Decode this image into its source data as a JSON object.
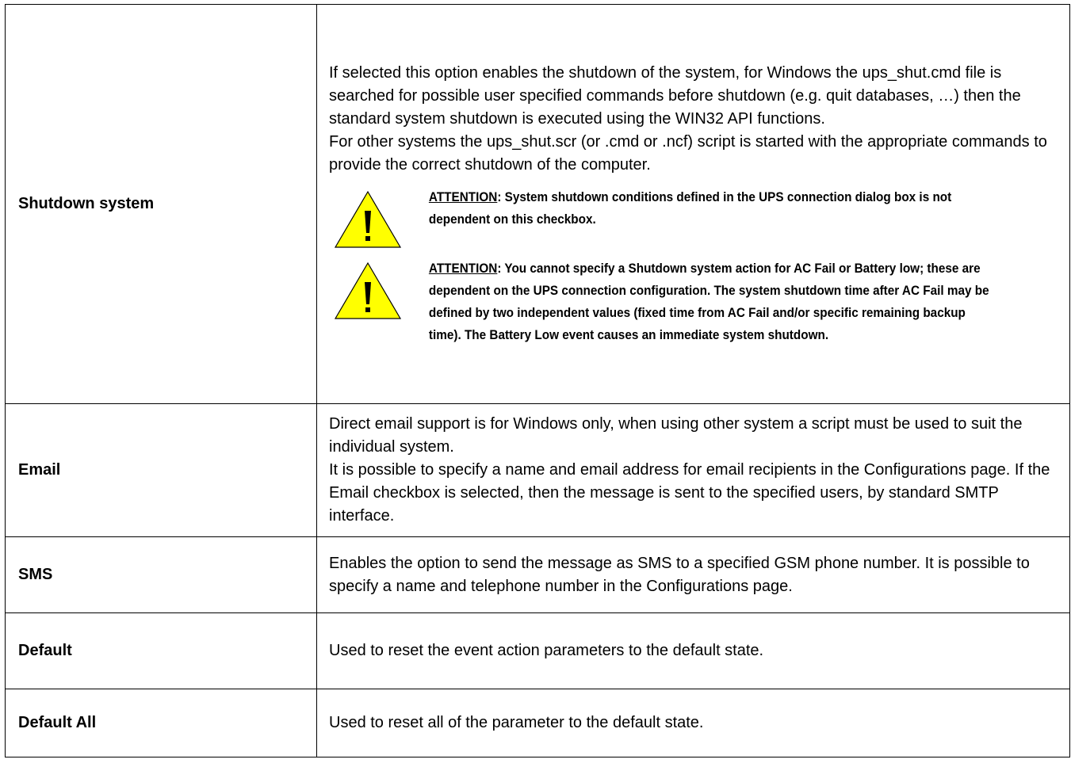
{
  "rows": [
    {
      "label": "Shutdown system",
      "paragraphs": [
        "If selected this option enables the shutdown of the system, for Windows the ups_shut.cmd file is searched for possible user specified commands before shutdown (e.g. quit databases, …) then the standard system shutdown is executed using the WIN32 API functions.",
        "For other systems the ups_shut.scr (or .cmd or .ncf) script is started with the appropriate commands to provide the correct shutdown of the computer."
      ],
      "attentions": [
        {
          "icon": "warning-triangle-icon",
          "label": "ATTENTION",
          "text": ": System shutdown conditions defined in the UPS connection dialog box is not dependent on this checkbox."
        },
        {
          "icon": "warning-triangle-icon",
          "label": "ATTENTION",
          "text": ": You cannot specify a Shutdown system action for AC Fail or Battery low; these are dependent on the UPS connection configuration. The system shutdown time after AC Fail may be defined by two independent values (fixed time from AC Fail and/or specific remaining backup time). The Battery Low event causes an immediate system shutdown."
        }
      ]
    },
    {
      "label": "Email",
      "paragraphs": [
        "Direct email support is for Windows only, when using other system a script must be used to suit the individual system.",
        "It is possible to specify a name and email address for email recipients in the Configurations page. If the Email checkbox is selected, then the message is sent to the specified users, by standard SMTP interface."
      ]
    },
    {
      "label": "SMS",
      "paragraphs": [
        "Enables the option to send the message as SMS to a specified GSM phone number. It is possible to specify a name and telephone number in the Configurations page."
      ]
    },
    {
      "label": "Default",
      "paragraphs": [
        "Used to reset the event action parameters to the default state."
      ]
    },
    {
      "label": "Default All",
      "paragraphs": [
        "Used to reset all of the parameter to the default state."
      ]
    }
  ],
  "colors": {
    "warning_fill": "#ffff00",
    "border": "#000000"
  }
}
